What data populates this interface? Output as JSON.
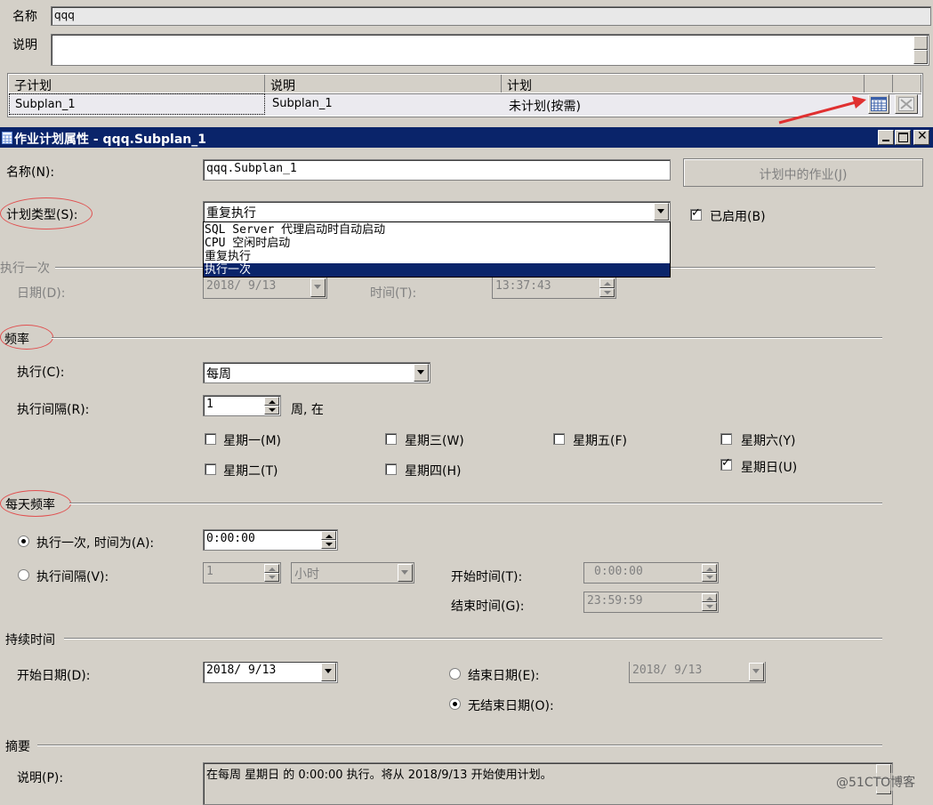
{
  "top": {
    "name_label": "名称",
    "name_value": "qqq",
    "desc_label": "说明",
    "desc_value": "",
    "grid": {
      "columns": [
        "子计划",
        "说明",
        "计划"
      ],
      "rows": [
        {
          "subplan": "Subplan_1",
          "description": "Subplan_1",
          "schedule": "未计划(按需)"
        }
      ]
    }
  },
  "dialog": {
    "title": "作业计划属性 - qqq.Subplan_1",
    "name_label": "名称(N):",
    "name_value": "qqq.Subplan_1",
    "jobs_button": "计划中的作业(J)",
    "schedule_type_label": "计划类型(S):",
    "schedule_type_value": "重复执行",
    "enabled_label": "已启用(B)",
    "enabled": true,
    "schedule_type_options": [
      "SQL Server 代理启动时自动启动",
      "CPU 空闲时启动",
      "重复执行",
      "执行一次"
    ],
    "highlighted_option": "执行一次",
    "one_time": {
      "section": "执行一次",
      "date_label": "日期(D):",
      "date_value": "2018/ 9/13",
      "time_label": "时间(T):",
      "time_value": "13:37:43"
    },
    "frequency": {
      "section": "频率",
      "occurs_label": "执行(C):",
      "occurs_value": "每周",
      "recurs_label": "执行间隔(R):",
      "recurs_value": "1",
      "recurs_unit": "周, 在",
      "days": [
        {
          "label": "星期一(M)",
          "checked": false
        },
        {
          "label": "星期二(T)",
          "checked": false
        },
        {
          "label": "星期三(W)",
          "checked": false
        },
        {
          "label": "星期四(H)",
          "checked": false
        },
        {
          "label": "星期五(F)",
          "checked": false
        },
        {
          "label": "星期六(Y)",
          "checked": false
        },
        {
          "label": "星期日(U)",
          "checked": true
        }
      ]
    },
    "daily": {
      "section": "每天频率",
      "once_label": "执行一次, 时间为(A):",
      "once_value": "0:00:00",
      "every_label": "执行间隔(V):",
      "every_value": "1",
      "every_unit": "小时",
      "start_label": "开始时间(T):",
      "start_value": "0:00:00",
      "end_label": "结束时间(G):",
      "end_value": "23:59:59"
    },
    "duration": {
      "section": "持续时间",
      "start_label": "开始日期(D):",
      "start_value": "2018/ 9/13",
      "end_date_label": "结束日期(E):",
      "end_date_value": "2018/ 9/13",
      "no_end_label": "无结束日期(O):"
    },
    "summary": {
      "section": "摘要",
      "desc_label": "说明(P):",
      "desc_value": "在每周 星期日 的 0:00:00 执行。将从 2018/9/13 开始使用计划。"
    }
  },
  "watermark": "@51CTO博客",
  "colors": {
    "title_bar": "#0a246a",
    "annotation": "#e03030",
    "window_bg": "#d4d0c8"
  }
}
